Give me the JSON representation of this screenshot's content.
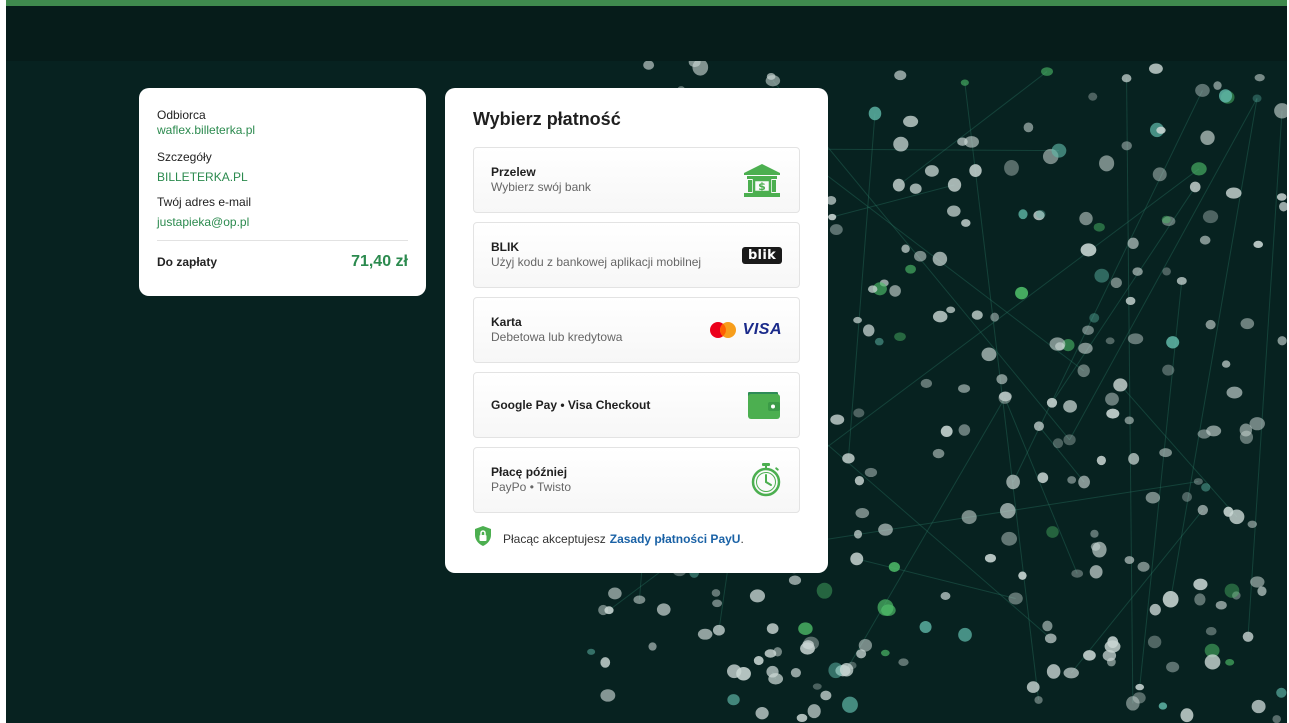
{
  "summary": {
    "recipient_label": "Odbiorca",
    "recipient_value": "waflex.billeterka.pl",
    "details_label": "Szczegóły",
    "details_value": "BILLETERKA.PL",
    "email_label": "Twój adres e-mail",
    "email_value": "justapieka@op.pl",
    "total_label": "Do zapłaty",
    "total_value": "71,40 zł"
  },
  "payment": {
    "title": "Wybierz płatność",
    "methods": [
      {
        "name": "Przelew",
        "desc": "Wybierz swój bank",
        "icon": "bank-icon"
      },
      {
        "name": "BLIK",
        "desc": "Użyj kodu z bankowej aplikacji mobilnej",
        "icon": "blik-logo",
        "badge": "blik"
      },
      {
        "name": "Karta",
        "desc": "Debetowa lub kredytowa",
        "icon": "card-brands-icon",
        "badge": "VISA"
      },
      {
        "name": "Google Pay • Visa Checkout",
        "desc": "",
        "icon": "wallet-icon"
      },
      {
        "name": "Płacę później",
        "desc": "PayPo • Twisto",
        "icon": "stopwatch-icon"
      }
    ],
    "terms_text": "Płacąc akceptujesz",
    "terms_link": "Zasady płatności PayU",
    "terms_end": "."
  },
  "colors": {
    "accent": "#2b8a4e",
    "icon_green": "#4caf50",
    "background": "#072220",
    "link": "#1a62a6"
  }
}
